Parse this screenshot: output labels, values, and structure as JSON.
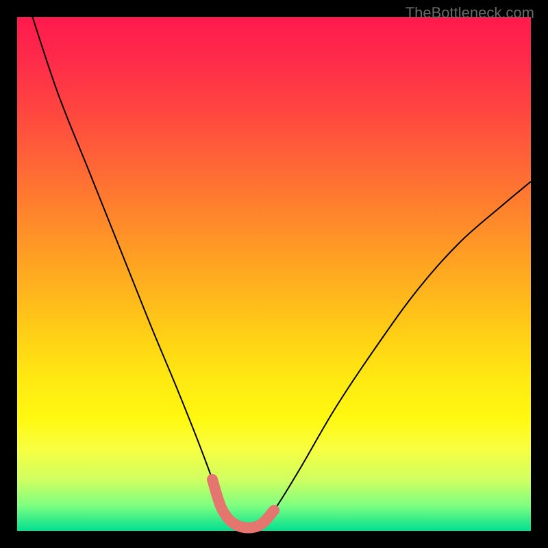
{
  "watermark": "TheBottleneck.com",
  "chart_data": {
    "type": "line",
    "title": "",
    "xlabel": "",
    "ylabel": "",
    "xlim": [
      0,
      100
    ],
    "ylim": [
      0,
      100
    ],
    "grid": false,
    "legend": false,
    "series": [
      {
        "name": "bottleneck-curve",
        "x": [
          3,
          8,
          14,
          20,
          26,
          31,
          35,
          38,
          40,
          43,
          47,
          50,
          55,
          62,
          70,
          78,
          86,
          94,
          100
        ],
        "y": [
          100,
          85,
          70,
          55,
          40,
          28,
          18,
          10,
          4,
          1,
          1,
          4,
          12,
          24,
          36,
          47,
          56,
          63,
          68
        ],
        "stroke": "#000000"
      },
      {
        "name": "optimal-zone-highlight",
        "x": [
          38,
          40,
          43,
          47,
          50
        ],
        "y": [
          10,
          4,
          1,
          1,
          4
        ],
        "stroke": "#e4756f",
        "stroke_width_px": 16
      }
    ],
    "annotations": [
      {
        "text": "TheBottleneck.com",
        "position": "top-right",
        "color": "#6a6a6a"
      }
    ],
    "background": {
      "type": "vertical-gradient",
      "stops": [
        {
          "offset": 0.0,
          "color": "#ff1a4d"
        },
        {
          "offset": 0.5,
          "color": "#ffaa20"
        },
        {
          "offset": 0.8,
          "color": "#fff810"
        },
        {
          "offset": 1.0,
          "color": "#00e090"
        }
      ]
    }
  }
}
